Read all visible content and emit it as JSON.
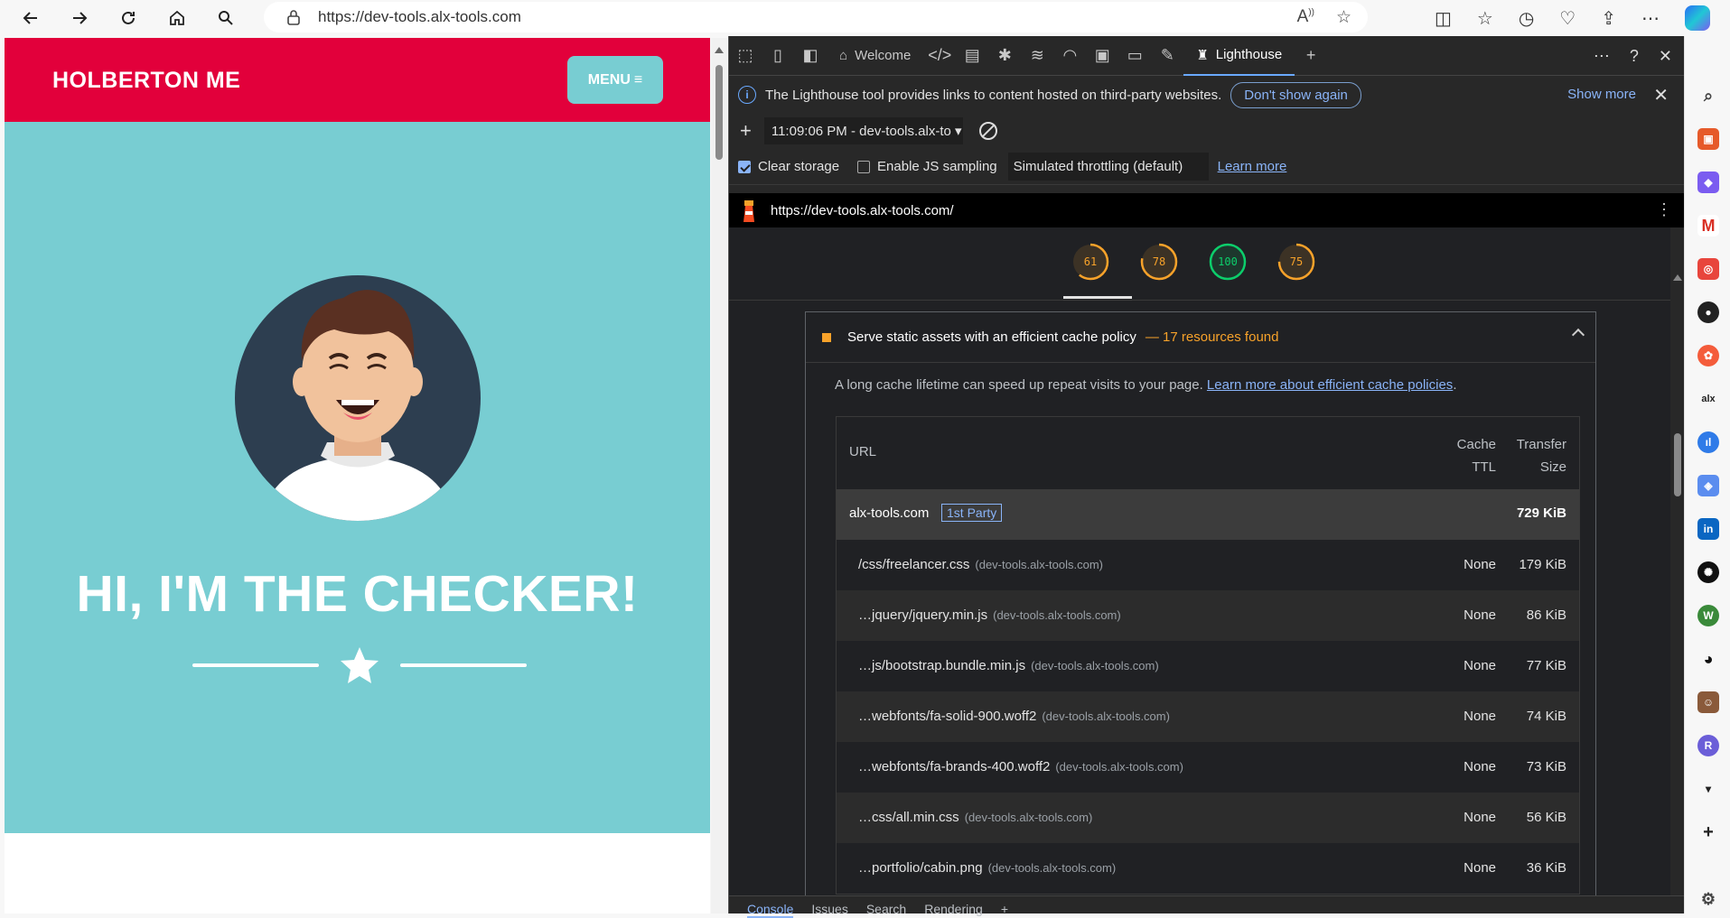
{
  "browser": {
    "address": "https://dev-tools.alx-tools.com"
  },
  "site": {
    "brand": "HOLBERTON ME",
    "menu_label": "MENU",
    "hero_title": "HI, I'M THE CHECKER!",
    "colors": {
      "header": "#e2003b",
      "hero": "#78cdd2"
    }
  },
  "devtools": {
    "tabs": [
      {
        "label": "Welcome",
        "icon": "home-icon"
      },
      {
        "label": "Lighthouse",
        "icon": "lighthouse-icon"
      }
    ],
    "infobar": {
      "message": "The Lighthouse tool provides links to content hosted on third-party websites.",
      "dont_show": "Don't show again",
      "show_more": "Show more"
    },
    "report_select": "11:09:06 PM - dev-tools.alx-to",
    "options": {
      "clear_storage": "Clear storage",
      "js_sampling": "Enable JS sampling",
      "throttling": "Simulated throttling (default)",
      "learn_more": "Learn more"
    },
    "url": "https://dev-tools.alx-tools.com/",
    "scores": [
      {
        "value": "61",
        "color": "#f7a22a",
        "fraction": 0.61
      },
      {
        "value": "78",
        "color": "#f7a22a",
        "fraction": 0.78
      },
      {
        "value": "100",
        "color": "#0cce6b",
        "fraction": 1.0
      },
      {
        "value": "75",
        "color": "#f7a22a",
        "fraction": 0.75
      }
    ],
    "audit": {
      "title": "Serve static assets with an efficient cache policy",
      "subtitle": "— 17 resources found",
      "description": "A long cache lifetime can speed up repeat visits to your page.",
      "link": "Learn more about efficient cache policies",
      "table": {
        "col_url": "URL",
        "col_ttl_1": "Cache",
        "col_ttl_2": "TTL",
        "col_size_1": "Transfer",
        "col_size_2": "Size",
        "group": {
          "name": "alx-tools.com",
          "badge": "1st Party",
          "size": "729 KiB"
        },
        "rows": [
          {
            "path": "/css/freelancer.css",
            "host": "(dev-tools.alx-tools.com)",
            "ttl": "None",
            "size": "179 KiB"
          },
          {
            "path": "…jquery/jquery.min.js",
            "host": "(dev-tools.alx-tools.com)",
            "ttl": "None",
            "size": "86 KiB"
          },
          {
            "path": "…js/bootstrap.bundle.min.js",
            "host": "(dev-tools.alx-tools.com)",
            "ttl": "None",
            "size": "77 KiB"
          },
          {
            "path": "…webfonts/fa-solid-900.woff2",
            "host": "(dev-tools.alx-tools.com)",
            "ttl": "None",
            "size": "74 KiB"
          },
          {
            "path": "…webfonts/fa-brands-400.woff2",
            "host": "(dev-tools.alx-tools.com)",
            "ttl": "None",
            "size": "73 KiB"
          },
          {
            "path": "…css/all.min.css",
            "host": "(dev-tools.alx-tools.com)",
            "ttl": "None",
            "size": "56 KiB"
          },
          {
            "path": "…portfolio/cabin.png",
            "host": "(dev-tools.alx-tools.com)",
            "ttl": "None",
            "size": "36 KiB"
          }
        ]
      }
    },
    "drawer_tabs": [
      "Console",
      "Issues",
      "Search",
      "Rendering"
    ]
  }
}
